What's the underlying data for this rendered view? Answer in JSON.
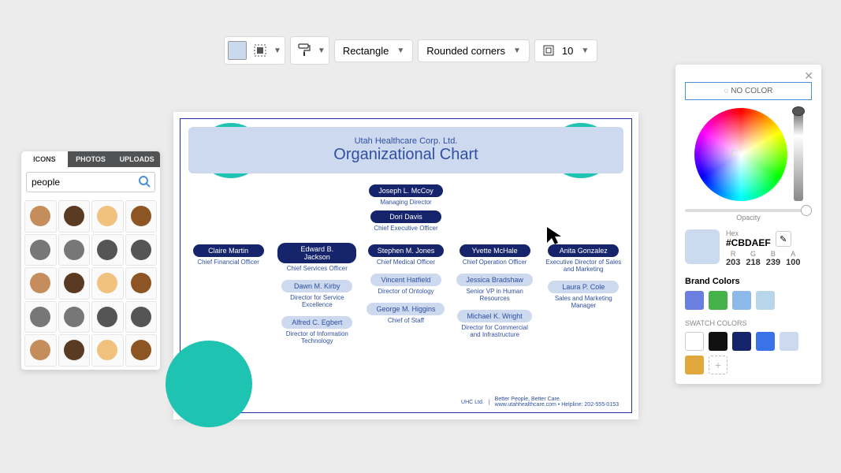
{
  "toolbar": {
    "shape_label": "Rectangle",
    "corners_label": "Rounded corners",
    "border_value": "10"
  },
  "icons_panel": {
    "tabs": [
      "ICONS",
      "PHOTOS",
      "UPLOADS"
    ],
    "search_value": "people"
  },
  "chart": {
    "subtitle": "Utah Healthcare Corp. Ltd.",
    "title": "Organizational Chart",
    "root": {
      "name": "Joseph L. McCoy",
      "role": "Managing Director"
    },
    "l2": {
      "name": "Dori Davis",
      "role": "Chief Executive Officer"
    },
    "cols": [
      {
        "head": {
          "name": "Claire Martin",
          "role": "Chief Financial Officer"
        },
        "children": []
      },
      {
        "head": {
          "name": "Edward B. Jackson",
          "role": "Chief Services Officer"
        },
        "children": [
          {
            "name": "Dawn M. Kirby",
            "role": "Director for Service Excellence"
          },
          {
            "name": "Alfred C. Egbert",
            "role": "Director of Information Technology"
          }
        ]
      },
      {
        "head": {
          "name": "Stephen M. Jones",
          "role": "Chief Medical Officer"
        },
        "children": [
          {
            "name": "Vincent Hatfield",
            "role": "Director of Ontology"
          },
          {
            "name": "George M. Higgins",
            "role": "Chief of Staff"
          }
        ]
      },
      {
        "head": {
          "name": "Yvette McHale",
          "role": "Chief Operation Officer"
        },
        "children": [
          {
            "name": "Jessica Bradshaw",
            "role": "Senior VP in Human Resources"
          },
          {
            "name": "Michael K. Wright",
            "role": "Director for Commercial and Infrastructure"
          }
        ]
      },
      {
        "head": {
          "name": "Anita Gonzalez",
          "role": "Executive Director of Sales and Marketing"
        },
        "children": [
          {
            "name": "Laura P. Cole",
            "role": "Sales and Marketing Manager"
          }
        ]
      }
    ],
    "footer_brand": "UHC Ltd.",
    "footer_tag": "Better People, Better Care.",
    "footer_info": "www.utahhealthcare.com • Helpline: 202-555-0153"
  },
  "color_panel": {
    "no_color_label": "NO COLOR",
    "opacity_label": "Opacity",
    "hex_label": "Hex",
    "hex_value": "#CBDAEF",
    "rgba": {
      "r": "203",
      "g": "218",
      "b": "239",
      "a": "100"
    },
    "brand_label": "Brand Colors",
    "brand_swatches": [
      "#6a7fe0",
      "#46b24a",
      "#8cb9ea",
      "#b8d5ea"
    ],
    "swatch_label": "SWATCH COLORS",
    "swatches": [
      "#ffffff",
      "#111111",
      "#16256b",
      "#3a72e8",
      "#cdd9ef",
      "#e1a93d"
    ]
  }
}
